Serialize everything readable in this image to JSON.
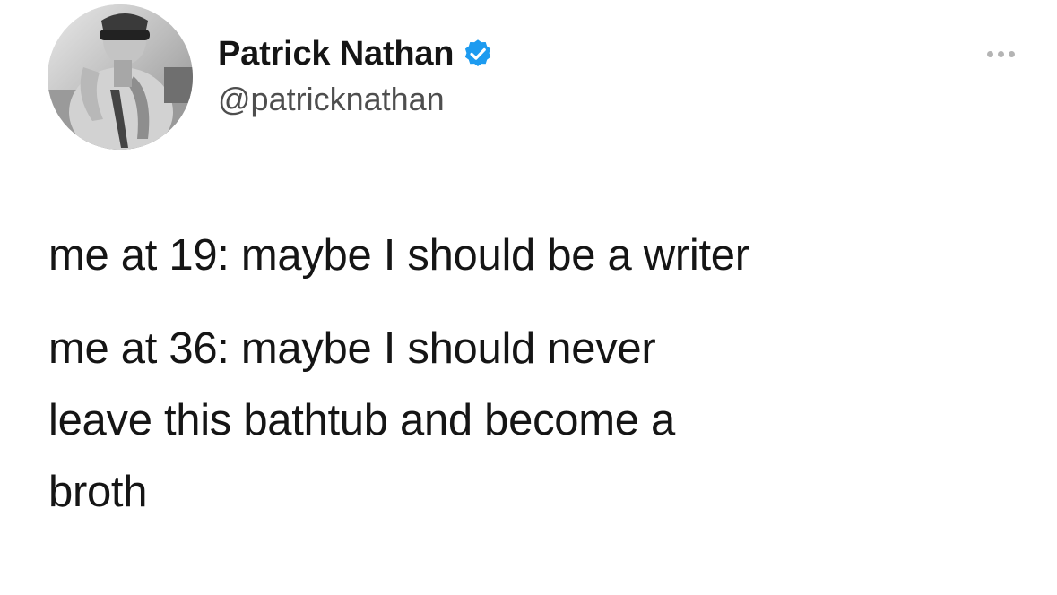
{
  "author": {
    "display_name": "Patrick Nathan",
    "handle": "@patricknathan",
    "verified": true,
    "verified_color": "#1d9bf0",
    "avatar_icon": "profile-photo"
  },
  "more_icon": "more-horizontal-icon",
  "tweet": {
    "paragraphs": [
      [
        "me at 19: maybe I should be a writer"
      ],
      [
        "me at 36: maybe I should never",
        "leave this bathtub and become a",
        "broth"
      ]
    ]
  }
}
